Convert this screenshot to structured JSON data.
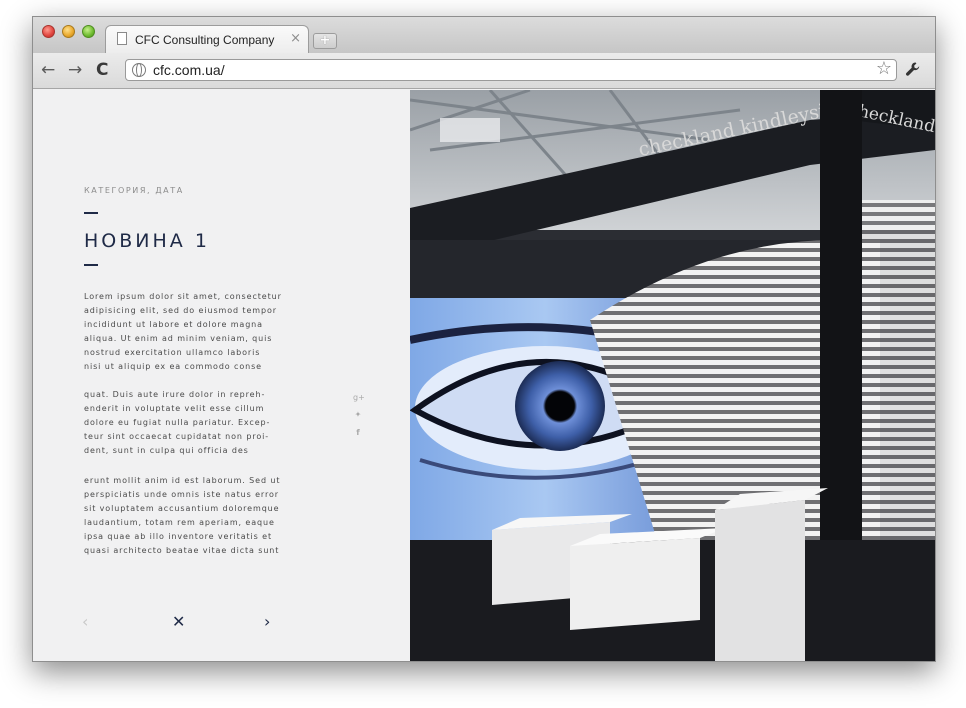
{
  "browser": {
    "tab_title": "CFC Consulting Company",
    "tab_close": "×",
    "new_tab": "+",
    "url": "cfc.com.ua/",
    "back": "←",
    "forward": "→",
    "reload": "C",
    "star": "☆",
    "wrench": "🔧"
  },
  "article": {
    "category": "КАТЕГОРИЯ, ДАТА",
    "title": "НОВИНА 1",
    "paragraph_1": "Lorem ipsum dolor sit amet, consectetur\nadipisicing elit, sed do eiusmod tempor\nincididunt ut labore et dolore magna\naliqua. Ut enim ad minim veniam, quis\nnostrud exercitation ullamco laboris\nnisi ut aliquip ex ea commodo conse",
    "paragraph_2": "quat. Duis aute irure dolor in repreh-\nenderit in voluptate velit esse cillum\ndolore eu fugiat nulla pariatur. Excep-\nteur sint occaecat cupidatat non proi-\ndent, sunt in culpa qui officia des",
    "paragraph_3": "erunt mollit anim id est laborum. Sed ut\nperspiciatis unde omnis iste natus error\nsit voluptatem accusantium doloremque\nlaudantium, totam rem aperiam, eaque\nipsa quae ab illo inventore veritatis et\nquasi architecto beatae vitae dicta sunt"
  },
  "social": {
    "gplus": "g+",
    "twitter": "✦",
    "facebook": "f"
  },
  "pager": {
    "prev": "‹",
    "close": "✕",
    "next": "›"
  },
  "photo": {
    "sign_text": "checkland kindleysides",
    "sign_text_2": "checkland kind"
  }
}
